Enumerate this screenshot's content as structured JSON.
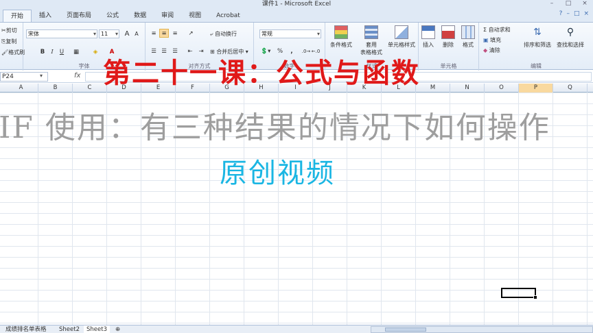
{
  "window": {
    "title": "课件1 - Microsoft Excel",
    "controls": [
      "–",
      "□",
      "×"
    ]
  },
  "tabs": [
    {
      "label": "开始",
      "active": true
    },
    {
      "label": "插入"
    },
    {
      "label": "页面布局"
    },
    {
      "label": "公式"
    },
    {
      "label": "数据"
    },
    {
      "label": "审阅"
    },
    {
      "label": "视图"
    },
    {
      "label": "Acrobat"
    }
  ],
  "ribbon": {
    "clipboard": {
      "cut": "剪切",
      "copy": "复制",
      "format_painter": "格式刷"
    },
    "font": {
      "name": "宋体",
      "size": "11",
      "label": "字体",
      "grow": "A",
      "shrink": "A",
      "bold": "B",
      "italic": "I",
      "underline": "U"
    },
    "alignment": {
      "wrap": "自动换行",
      "merge": "合并后居中",
      "label": "对齐方式"
    },
    "number": {
      "format": "常规",
      "percent": "%",
      "comma": ",",
      "label": "数字"
    },
    "styles": {
      "conditional": "条件格式",
      "table": "套用\n表格格式",
      "cell_styles": "单元格样式",
      "label": "样式"
    },
    "cells": {
      "insert": "插入",
      "delete": "删除",
      "format": "格式",
      "label": "单元格"
    },
    "editing": {
      "autosum": "Σ 自动求和",
      "fill": "填充",
      "clear": "清除",
      "sort": "排序和筛选",
      "find": "查找和选择",
      "label": "编辑"
    }
  },
  "formula_bar": {
    "name_box": "P24",
    "fx": "fx",
    "formula": ""
  },
  "columns": [
    "A",
    "B",
    "C",
    "D",
    "E",
    "F",
    "G",
    "H",
    "I",
    "J",
    "K",
    "L",
    "M",
    "N",
    "O",
    "P",
    "Q",
    "R"
  ],
  "selected_column": "P",
  "sheets": [
    {
      "label": "成绩排名单表格"
    },
    {
      "label": "Sheet2"
    },
    {
      "label": "Sheet3",
      "active": true
    }
  ],
  "overlay": {
    "title": "第二十一课：公式与函数",
    "subtitle": "IF 使用：有三种结果的情况下如何操作",
    "tag": "原创视频"
  },
  "colors": {
    "title": "#e01919",
    "subtitle": "#9e9e9e",
    "tag": "#1ab6e3",
    "ribbon": "#dfe9f5"
  }
}
